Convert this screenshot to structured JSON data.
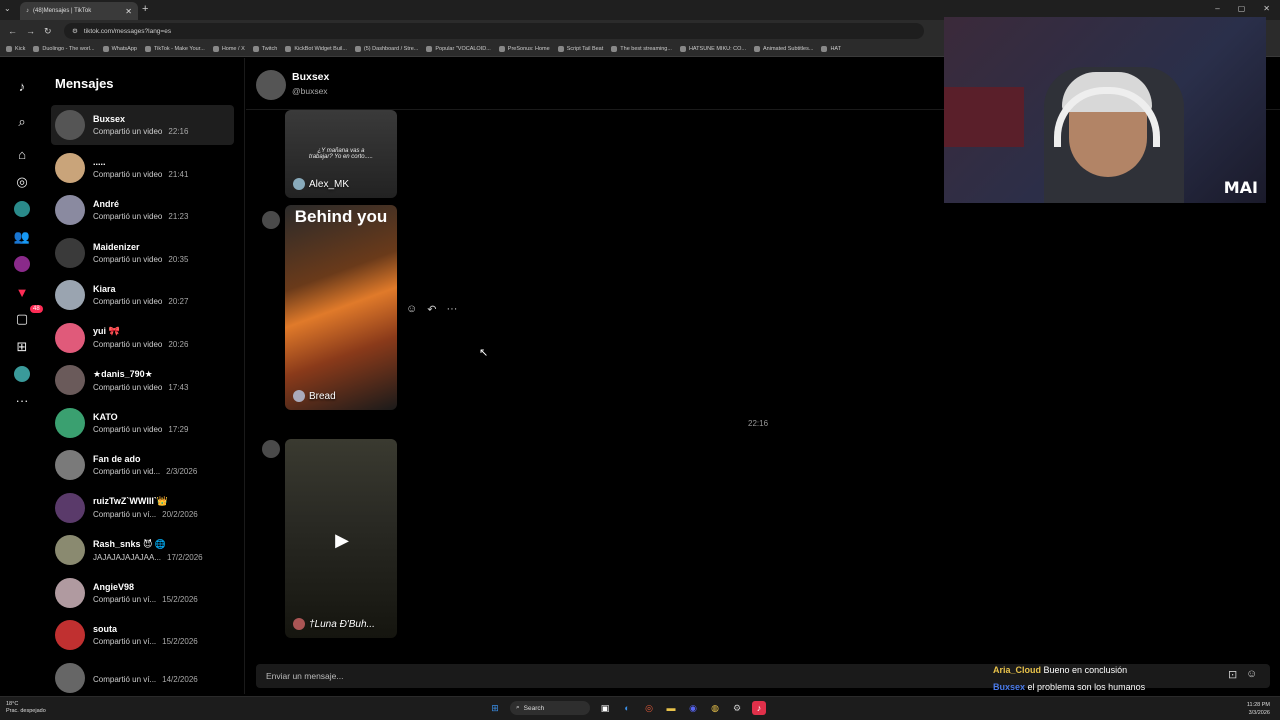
{
  "browser": {
    "tab_title": "(48)Mensajes | TikTok",
    "url": "tiktok.com/messages?lang=es",
    "bookmarks": [
      "Kick",
      "Duolingo - The worl...",
      "WhatsApp",
      "TikTok - Make Your...",
      "Home / X",
      "Twitch",
      "KickBot Widget Buil...",
      "(5) Dashboard / Stre...",
      "Popular \"VOCALOID...",
      "PreSonus: Home",
      "Script Tail Beat",
      "The best streaming...",
      "HATSUNE MIKU: CO...",
      "Animated Subtitles...",
      "HAT"
    ]
  },
  "rail": {
    "inbox_badge": "48"
  },
  "conversations": {
    "title": "Mensajes",
    "items": [
      {
        "name": "Buxsex",
        "preview": "Compartió un video",
        "time": "22:16",
        "color": "#555"
      },
      {
        "name": ".....",
        "preview": "Compartió un video",
        "time": "21:41",
        "color": "#c9a47a"
      },
      {
        "name": "André",
        "preview": "Compartió un video",
        "time": "21:23",
        "color": "#8a8aa0"
      },
      {
        "name": "Maidenizer",
        "preview": "Compartió un video",
        "time": "20:35",
        "color": "#3a3a3a"
      },
      {
        "name": "Kiara",
        "preview": "Compartió un video",
        "time": "20:27",
        "color": "#9aa4b0"
      },
      {
        "name": "yui 🎀",
        "preview": "Compartió un video",
        "time": "20:26",
        "color": "#e05a7a"
      },
      {
        "name": "★danis_790★",
        "preview": "Compartió un video",
        "time": "17:43",
        "color": "#6a5a5a"
      },
      {
        "name": "KATO",
        "preview": "Compartió un video",
        "time": "17:29",
        "color": "#3aa070"
      },
      {
        "name": "Fan de ado",
        "preview": "Compartió un vid...",
        "time": "2/3/2026",
        "color": "#7a7a7a"
      },
      {
        "name": "ruizTwZ`WWIII`👑",
        "preview": "Compartió un ví...",
        "time": "20/2/2026",
        "color": "#5a3a6a"
      },
      {
        "name": "Rash_snks 😈 🌐",
        "preview": "JAJAJAJAJAJAA...",
        "time": "17/2/2026",
        "color": "#8a8a70"
      },
      {
        "name": "AngieV98",
        "preview": "Compartió un ví...",
        "time": "15/2/2026",
        "color": "#b09aa0"
      },
      {
        "name": "souta",
        "preview": "Compartió un ví...",
        "time": "15/2/2026",
        "color": "#c03030"
      },
      {
        "name": "",
        "preview": "Compartió un ví...",
        "time": "14/2/2026",
        "color": "#666"
      }
    ]
  },
  "chat": {
    "name": "Buxsex",
    "handle": "@buxsex",
    "videos": [
      {
        "caption": "¿Y mañana vas a trabajar? Yo en corto.....",
        "author": "Alex_MK"
      },
      {
        "caption": "Behind you",
        "author": "Bread"
      },
      {
        "caption": "",
        "author": "†Luna Ɖ'Buh..."
      }
    ],
    "timestamp": "22:16",
    "composer_placeholder": "Enviar un mensaje..."
  },
  "stream_chat": [
    {
      "user": "Aria_Cloud",
      "text": "Bueno en conclusión"
    },
    {
      "user": "Buxsex",
      "text": "el problema son los humanos"
    }
  ],
  "webcam": {
    "tag": "MAI"
  },
  "taskbar": {
    "weather_temp": "18°C",
    "weather_desc": "Prac. despejado",
    "search_label": "Search",
    "time": "11:28 PM",
    "date": "3/3/2026"
  }
}
